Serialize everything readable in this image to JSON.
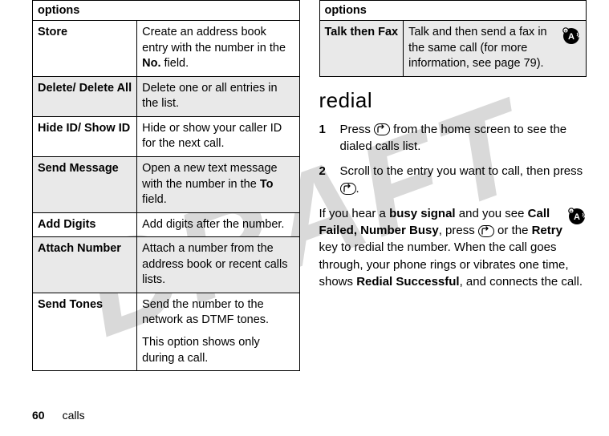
{
  "left_table": {
    "header": "options",
    "rows": [
      {
        "term": "Store",
        "desc_pre": "Create an address book entry with the number in the ",
        "desc_bold": "No.",
        "desc_post": " field.",
        "shade": false
      },
      {
        "term": "Delete/ Delete All",
        "desc_pre": "Delete one or all entries in the list.",
        "desc_bold": "",
        "desc_post": "",
        "shade": true
      },
      {
        "term": "Hide ID/ Show ID",
        "desc_pre": "Hide or show your caller ID for the next call.",
        "desc_bold": "",
        "desc_post": "",
        "shade": false
      },
      {
        "term": "Send Message",
        "desc_pre": "Open a new text message with the number in the ",
        "desc_bold": "To",
        "desc_post": " field.",
        "shade": true
      },
      {
        "term": "Add Digits",
        "desc_pre": "Add digits after the number.",
        "desc_bold": "",
        "desc_post": "",
        "shade": false
      },
      {
        "term": "Attach Number",
        "desc_pre": "Attach a number from the address book or recent calls lists.",
        "desc_bold": "",
        "desc_post": "",
        "shade": true
      },
      {
        "term": "Send Tones",
        "desc_pre": "Send the number to the network as DTMF tones.",
        "desc_bold": "",
        "desc_post": "",
        "extra": "This option shows only during a call.",
        "shade": false
      }
    ]
  },
  "right_table": {
    "header": "options",
    "rows": [
      {
        "term": "Talk then Fax",
        "desc": "Talk and then send a fax in the same call (for more information, see page 79).",
        "shade": true,
        "has_icon": true
      }
    ]
  },
  "section_heading": "redial",
  "steps": [
    {
      "pre": "Press ",
      "key": "send",
      "post": " from the home screen to see the dialed calls list."
    },
    {
      "pre": "Scroll to the entry you want to call, then press ",
      "key": "send",
      "post": "."
    }
  ],
  "busy_para": {
    "t1": "If you hear a ",
    "b1": "busy signal",
    "t2": " and you see ",
    "c1": "Call Failed, Number Busy",
    "t3": ", press ",
    "key": "send",
    "t4": " or the ",
    "c2": "Retry",
    "t5": " key to redial the number. When the call goes through, your phone rings or vibrates one time, shows ",
    "c3": "Redial Successful",
    "t6": ", and connects the call."
  },
  "footer": {
    "page": "60",
    "chapter": "calls"
  },
  "watermark": "DRAFT"
}
